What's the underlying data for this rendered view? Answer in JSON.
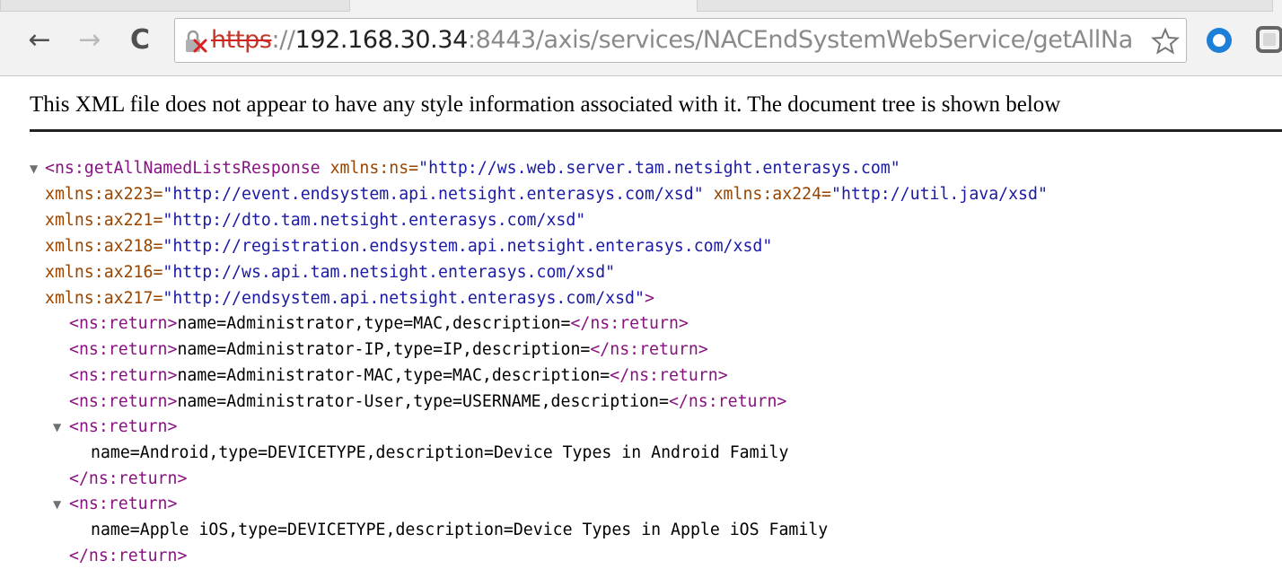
{
  "browser": {
    "nav": {
      "back_glyph": "←",
      "forward_glyph": "→",
      "reload_glyph": "C"
    },
    "omnibox": {
      "scheme": "https",
      "host_sep": "://",
      "host": "192.168.30.34",
      "path": ":8443/axis/services/NACEndSystemWebService/getAllNa"
    },
    "icons": {
      "lock": "broken-lock-icon",
      "star": "bookmark-star-icon",
      "ext1": "extension-ring-icon",
      "ext2": "extension-square-icon"
    }
  },
  "page": {
    "notice": "This XML file does not appear to have any style information associated with it. The document tree is shown below"
  },
  "xml": {
    "fold_glyph": "▼",
    "root": {
      "open_tag": "<ns:getAllNamedListsResponse",
      "ns_attr": "xmlns:ns=",
      "ns_val": "\"http://ws.web.server.tam.netsight.enterasys.com\"",
      "attrs": [
        {
          "name": "xmlns:ax223=",
          "value": "\"http://event.endsystem.api.netsight.enterasys.com/xsd\"",
          "name2": " xmlns:ax224=",
          "value2": "\"http://util.java/xsd\""
        },
        {
          "name": "xmlns:ax221=",
          "value": "\"http://dto.tam.netsight.enterasys.com/xsd\""
        },
        {
          "name": "xmlns:ax218=",
          "value": "\"http://registration.endsystem.api.netsight.enterasys.com/xsd\""
        },
        {
          "name": "xmlns:ax216=",
          "value": "\"http://ws.api.tam.netsight.enterasys.com/xsd\""
        },
        {
          "name": "xmlns:ax217=",
          "value": "\"http://endsystem.api.netsight.enterasys.com/xsd\"",
          "close": ">"
        }
      ]
    },
    "return_open": "<ns:return>",
    "return_close": "</ns:return>",
    "inline_returns": [
      "name=Administrator,type=MAC,description=",
      "name=Administrator-IP,type=IP,description=",
      "name=Administrator-MAC,type=MAC,description=",
      "name=Administrator-User,type=USERNAME,description="
    ],
    "block_returns": [
      "name=Android,type=DEVICETYPE,description=Device Types in Android Family",
      "name=Apple iOS,type=DEVICETYPE,description=Device Types in Apple iOS Family"
    ]
  }
}
